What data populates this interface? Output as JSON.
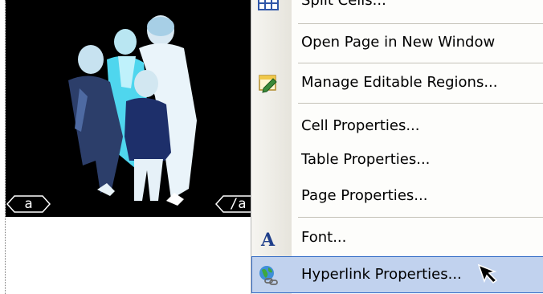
{
  "canvas": {
    "photo_alt": "inverted photo of four people",
    "tags": {
      "open": "a",
      "close": "/a"
    }
  },
  "menu": {
    "items": [
      {
        "label": "Split Cells...",
        "icon": "split-cells-icon",
        "cut_off": true
      },
      {
        "label": "Open Page in New Window",
        "icon": ""
      },
      {
        "label": "Manage Editable Regions...",
        "icon": "editable-regions-icon"
      },
      {
        "label": "Cell Properties...",
        "icon": ""
      },
      {
        "label": "Table Properties...",
        "icon": ""
      },
      {
        "label": "Page Properties...",
        "icon": ""
      },
      {
        "label": "Font...",
        "icon": "font-icon"
      },
      {
        "label": "Hyperlink Properties...",
        "icon": "hyperlink-icon",
        "highlighted": true
      }
    ]
  },
  "colors": {
    "highlight_fill": "#c1d2ee",
    "highlight_border": "#316ac5",
    "menu_background": "#fdfdfb",
    "photo_background": "#000000"
  }
}
